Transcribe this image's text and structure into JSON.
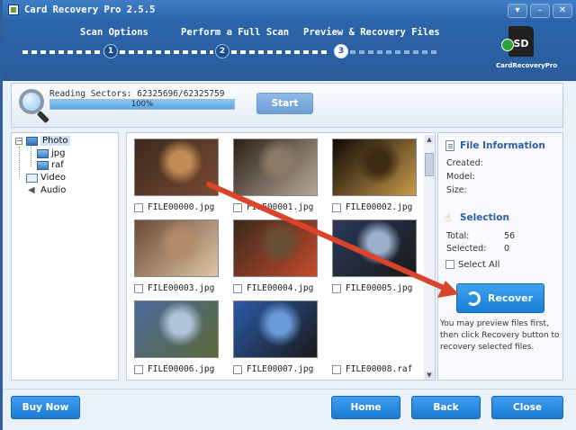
{
  "window": {
    "title": "Card Recovery Pro 2.5.5",
    "controls": {
      "menu": "▾",
      "minimize": "–",
      "close": "✕"
    }
  },
  "steps": [
    {
      "label": "Scan Options",
      "number": "1",
      "active": false
    },
    {
      "label": "Perform a Full Scan",
      "number": "2",
      "active": false
    },
    {
      "label": "Preview & Recovery Files",
      "number": "3",
      "active": true
    }
  ],
  "logo": {
    "card_text": "SD",
    "caption": "CardRecoveryPro"
  },
  "scan": {
    "reading_text": "Reading Sectors: 62325696/62325759",
    "progress_percent": 100,
    "progress_label": "100%",
    "start_label": "Start"
  },
  "tree": {
    "items": [
      {
        "label": "Photo",
        "level": 0,
        "expanded": true,
        "icon": "folder-image-icon"
      },
      {
        "label": "jpg",
        "level": 1,
        "icon": "image-file-icon"
      },
      {
        "label": "raf",
        "level": 1,
        "icon": "image-file-icon"
      },
      {
        "label": "Video",
        "level": 0,
        "icon": "video-icon"
      },
      {
        "label": "Audio",
        "level": 0,
        "icon": "speaker-icon"
      }
    ],
    "expander": "−"
  },
  "gallery": {
    "files": [
      {
        "name": "FILE00000.jpg",
        "thumb_colors": [
          "#3a2a1e",
          "#c28a55",
          "#7a4a30"
        ]
      },
      {
        "name": "FILE00001.jpg",
        "thumb_colors": [
          "#2b2118",
          "#8c7a66",
          "#b5a898"
        ]
      },
      {
        "name": "FILE00002.jpg",
        "thumb_colors": [
          "#0e0a06",
          "#3d2a14",
          "#c99a4a"
        ]
      },
      {
        "name": "FILE00003.jpg",
        "thumb_colors": [
          "#6a4a36",
          "#b38a6a",
          "#e0c6a6"
        ]
      },
      {
        "name": "FILE00004.jpg",
        "thumb_colors": [
          "#3a2a1c",
          "#6b4e36",
          "#c44a2a"
        ]
      },
      {
        "name": "FILE00005.jpg",
        "thumb_colors": [
          "#2a3a5a",
          "#9ab0cc",
          "#1a1a1a"
        ]
      },
      {
        "name": "FILE00006.jpg",
        "thumb_colors": [
          "#4a6a9a",
          "#b0c4d8",
          "#5a6a3a"
        ]
      },
      {
        "name": "FILE00007.jpg",
        "thumb_colors": [
          "#2a5aa8",
          "#6a9ad8",
          "#1a1a1a"
        ]
      },
      {
        "name": "FILE00008.raf",
        "thumb_colors": null
      }
    ]
  },
  "info": {
    "file_info_title": "File Information",
    "created_label": "Created:",
    "model_label": "Model:",
    "size_label": "Size:",
    "selection_title": "Selection",
    "total_label": "Total:",
    "total_value": "56",
    "selected_label": "Selected:",
    "selected_value": "0",
    "select_all_label": "Select All",
    "recover_label": "Recover",
    "hint": "You may preview files first, then click Recovery button to recovery selected files."
  },
  "footer": {
    "buy_label": "Buy Now",
    "home_label": "Home",
    "back_label": "Back",
    "close_label": "Close"
  },
  "annotation_color": "#d9442b"
}
